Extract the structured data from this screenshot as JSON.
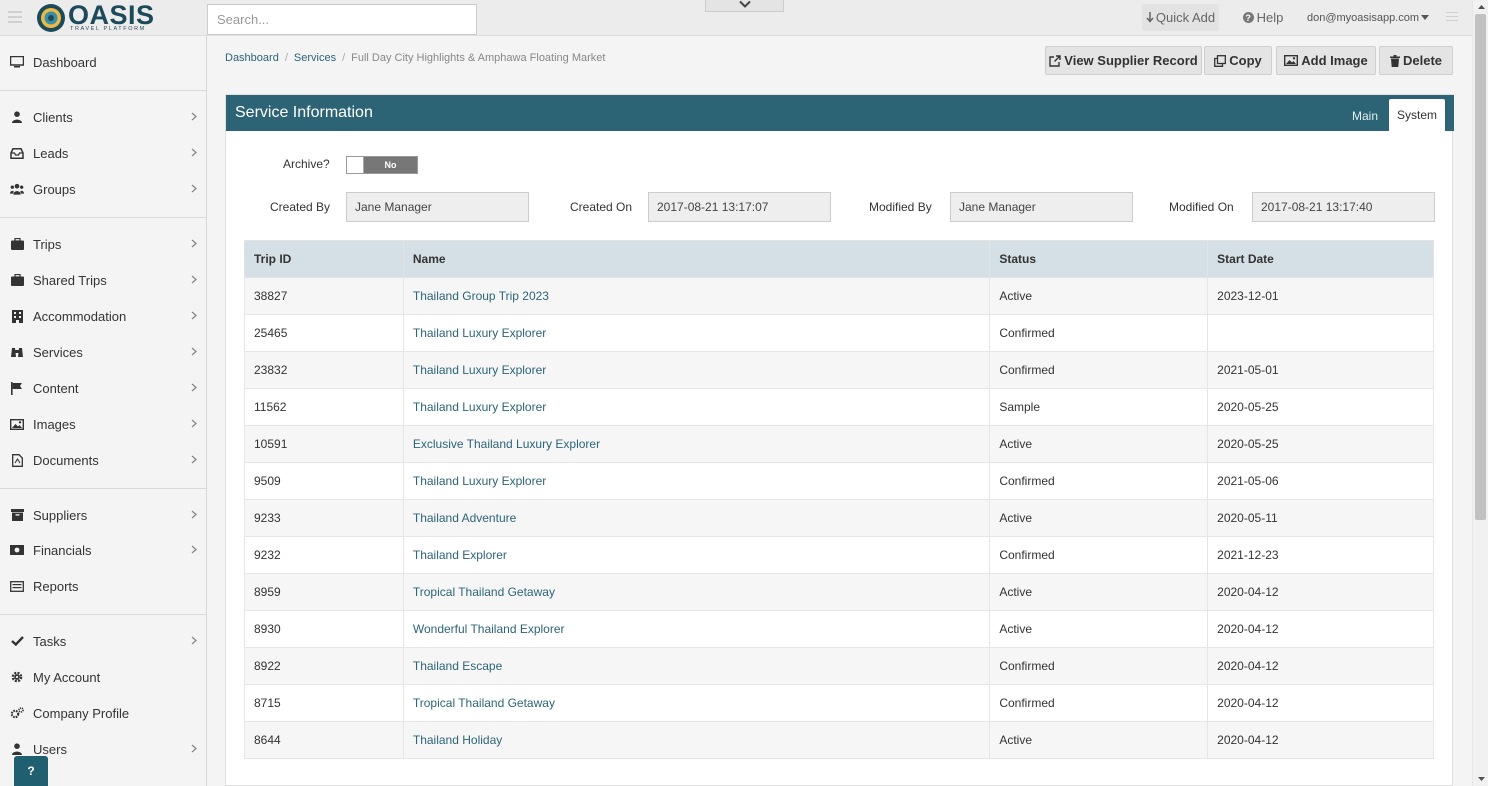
{
  "header": {
    "logo_text": "OASIS",
    "logo_subtitle": "TRAVEL PLATFORM",
    "search_placeholder": "Search...",
    "quick_add_label": "Quick Add",
    "help_label": "Help",
    "user_email": "don@myoasisapp.com"
  },
  "sidebar": {
    "items": [
      {
        "label": "Dashboard",
        "icon": "monitor-icon"
      },
      {
        "label": "Clients",
        "icon": "user-icon"
      },
      {
        "label": "Leads",
        "icon": "inbox-icon"
      },
      {
        "label": "Groups",
        "icon": "users-icon"
      },
      {
        "label": "Trips",
        "icon": "suitcase-icon"
      },
      {
        "label": "Shared Trips",
        "icon": "suitcase-icon"
      },
      {
        "label": "Accommodation",
        "icon": "building-icon"
      },
      {
        "label": "Services",
        "icon": "binoculars-icon"
      },
      {
        "label": "Content",
        "icon": "flag-icon"
      },
      {
        "label": "Images",
        "icon": "image-icon"
      },
      {
        "label": "Documents",
        "icon": "document-icon"
      },
      {
        "label": "Suppliers",
        "icon": "archive-icon"
      },
      {
        "label": "Financials",
        "icon": "money-icon"
      },
      {
        "label": "Reports",
        "icon": "list-icon"
      },
      {
        "label": "Tasks",
        "icon": "check-icon"
      },
      {
        "label": "My Account",
        "icon": "cog-icon"
      },
      {
        "label": "Company Profile",
        "icon": "cogs-icon"
      },
      {
        "label": "Users",
        "icon": "user-icon"
      }
    ],
    "help_bubble": "?"
  },
  "breadcrumb": {
    "items": [
      "Dashboard",
      "Services"
    ],
    "current": "Full Day City Highlights & Amphawa Floating Market"
  },
  "actions": {
    "view_supplier": "View Supplier Record",
    "copy": "Copy",
    "add_image": "Add Image",
    "delete": "Delete"
  },
  "panel": {
    "title": "Service Information",
    "tab_main": "Main",
    "tab_system": "System"
  },
  "form": {
    "archive_label": "Archive?",
    "archive_value": "No",
    "created_by_label": "Created By",
    "created_by": "Jane Manager",
    "created_on_label": "Created On",
    "created_on": "2017-08-21 13:17:07",
    "modified_by_label": "Modified By",
    "modified_by": "Jane Manager",
    "modified_on_label": "Modified On",
    "modified_on": "2017-08-21 13:17:40"
  },
  "trips_table": {
    "headers": [
      "Trip ID",
      "Name",
      "Status",
      "Start Date"
    ],
    "rows": [
      {
        "id": "38827",
        "name": "Thailand Group Trip 2023",
        "status": "Active",
        "start": "2023-12-01"
      },
      {
        "id": "25465",
        "name": "Thailand Luxury Explorer",
        "status": "Confirmed",
        "start": ""
      },
      {
        "id": "23832",
        "name": "Thailand Luxury Explorer",
        "status": "Confirmed",
        "start": "2021-05-01"
      },
      {
        "id": "11562",
        "name": "Thailand Luxury Explorer",
        "status": "Sample",
        "start": "2020-05-25"
      },
      {
        "id": "10591",
        "name": "Exclusive Thailand Luxury Explorer",
        "status": "Active",
        "start": "2020-05-25"
      },
      {
        "id": "9509",
        "name": "Thailand Luxury Explorer",
        "status": "Confirmed",
        "start": "2021-05-06"
      },
      {
        "id": "9233",
        "name": "Thailand Adventure",
        "status": "Active",
        "start": "2020-05-11"
      },
      {
        "id": "9232",
        "name": "Thailand Explorer",
        "status": "Confirmed",
        "start": "2021-12-23"
      },
      {
        "id": "8959",
        "name": "Tropical Thailand Getaway",
        "status": "Active",
        "start": "2020-04-12"
      },
      {
        "id": "8930",
        "name": "Wonderful Thailand Explorer",
        "status": "Active",
        "start": "2020-04-12"
      },
      {
        "id": "8922",
        "name": "Thailand Escape",
        "status": "Confirmed",
        "start": "2020-04-12"
      },
      {
        "id": "8715",
        "name": "Tropical Thailand Getaway",
        "status": "Confirmed",
        "start": "2020-04-12"
      },
      {
        "id": "8644",
        "name": "Thailand Holiday",
        "status": "Active",
        "start": "2020-04-12"
      }
    ]
  },
  "colors": {
    "brand": "#2c6475",
    "link": "#2c6478",
    "table_header": "#d4e0e6"
  }
}
